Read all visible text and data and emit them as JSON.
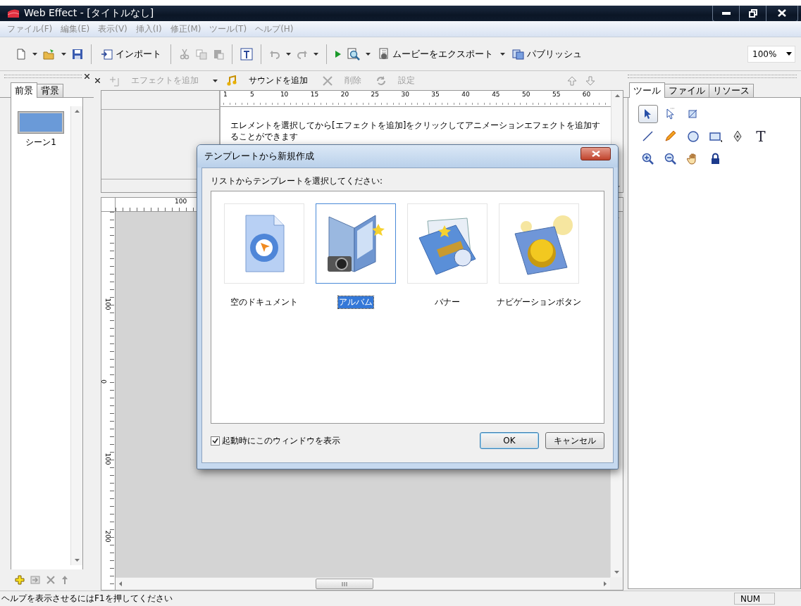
{
  "window": {
    "title": "Web Effect - [タイトルなし]"
  },
  "menu": [
    {
      "label": "ファイル(F)",
      "disabled": true
    },
    {
      "label": "編集(E)",
      "disabled": true
    },
    {
      "label": "表示(V)",
      "disabled": true
    },
    {
      "label": "挿入(I)",
      "disabled": true
    },
    {
      "label": "修正(M)",
      "disabled": true
    },
    {
      "label": "ツール(T)",
      "disabled": true
    },
    {
      "label": "ヘルプ(H)",
      "disabled": true
    }
  ],
  "toolbar": {
    "import_label": "インポート",
    "edit_buttons": [
      {
        "disabled": true
      },
      {
        "disabled": true
      },
      {
        "disabled": true
      }
    ],
    "history_buttons": [
      {
        "disabled": true
      },
      {
        "disabled": true
      }
    ],
    "export_label": "ムービーをエクスポート",
    "publish_label": "パブリッシュ",
    "zoom": "100%"
  },
  "left_panel": {
    "tabs": [
      {
        "label": "前景",
        "selected": true
      },
      {
        "label": "背景",
        "selected": false
      }
    ],
    "scenes": [
      {
        "label": "シーン1"
      }
    ]
  },
  "effects_toolbar": [
    {
      "label": "エフェクトを追加",
      "disabled": true
    },
    {
      "label": "サウンドを追加",
      "disabled": false
    },
    {
      "label": "削除",
      "disabled": true
    },
    {
      "label": "設定",
      "disabled": true
    }
  ],
  "timeline": {
    "ruler": [
      "1",
      "5",
      "10",
      "15",
      "20",
      "25",
      "30",
      "35",
      "40",
      "45",
      "50",
      "55",
      "60"
    ],
    "hint": "エレメントを選択してから[エフェクトを追加]をクリックしてアニメーションエフェクトを追加することができます"
  },
  "canvas": {
    "top_ruler": [
      "100"
    ],
    "side_ruler": [
      "100",
      "0",
      "100",
      "200"
    ]
  },
  "right_panel": {
    "tabs": [
      {
        "label": "ツール",
        "selected": true
      },
      {
        "label": "ファイル",
        "selected": false
      },
      {
        "label": "リソース",
        "selected": false
      }
    ],
    "tools": [
      {
        "selected": true
      },
      {
        "selected": false
      },
      {
        "selected": false
      },
      {
        "selected": false
      },
      {
        "selected": false
      },
      {
        "selected": false
      },
      {
        "selected": false
      },
      {
        "selected": false
      },
      {
        "selected": false,
        "glyph": "T"
      },
      {
        "selected": false
      },
      {
        "selected": false
      },
      {
        "selected": false
      },
      {
        "selected": false
      }
    ]
  },
  "dialog": {
    "title": "テンプレートから新規作成",
    "prompt": "リストからテンプレートを選択してください:",
    "templates": [
      {
        "label": "空のドキュメント",
        "selected": false
      },
      {
        "label": "アルバム",
        "selected": true
      },
      {
        "label": "バナー",
        "selected": false
      },
      {
        "label": "ナビゲーションボタン",
        "selected": false
      }
    ],
    "show_on_startup": {
      "label": "起動時にこのウィンドウを表示",
      "checked": true
    },
    "buttons": [
      {
        "label": "OK",
        "default": true
      },
      {
        "label": "キャンセル",
        "default": false
      }
    ]
  },
  "status_bar": {
    "message": "ヘルプを表示させるにはF1を押してください",
    "indicator": "NUM"
  }
}
